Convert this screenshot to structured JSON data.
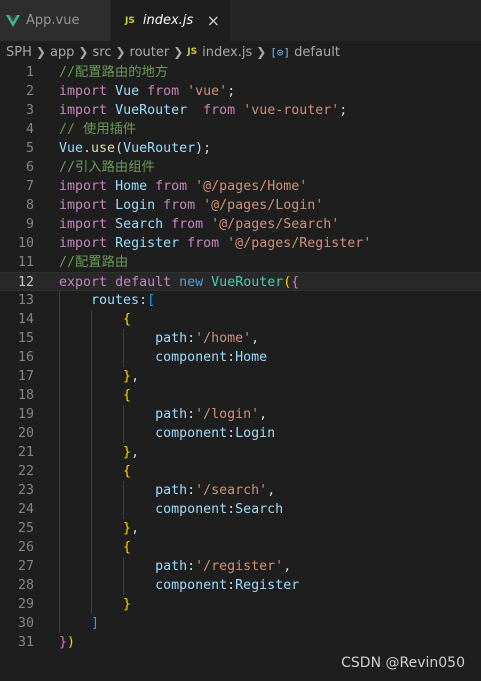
{
  "tabs": [
    {
      "label": "App.vue",
      "icon": "vue-icon",
      "active": false
    },
    {
      "label": "index.js",
      "icon": "js-icon",
      "active": true,
      "close": "×"
    }
  ],
  "breadcrumb": {
    "items": [
      "SPH",
      "app",
      "src",
      "router",
      "index.js",
      "default"
    ],
    "js_badge": "JS",
    "symbol_icon": "[⊙]"
  },
  "editor": {
    "current_line": 12,
    "lines": [
      [
        [
          "comment",
          "//配置路由的地方"
        ]
      ],
      [
        [
          "keyword",
          "import"
        ],
        [
          "plain",
          " "
        ],
        [
          "var",
          "Vue"
        ],
        [
          "plain",
          " "
        ],
        [
          "keyword",
          "from"
        ],
        [
          "plain",
          " "
        ],
        [
          "string",
          "'vue'"
        ],
        [
          "plain",
          ";"
        ]
      ],
      [
        [
          "keyword",
          "import"
        ],
        [
          "plain",
          " "
        ],
        [
          "var",
          "VueRouter"
        ],
        [
          "plain",
          "  "
        ],
        [
          "keyword",
          "from"
        ],
        [
          "plain",
          " "
        ],
        [
          "string",
          "'vue-router'"
        ],
        [
          "plain",
          ";"
        ]
      ],
      [
        [
          "comment",
          "// 使用插件"
        ]
      ],
      [
        [
          "var",
          "Vue"
        ],
        [
          "plain",
          "."
        ],
        [
          "fn",
          "use"
        ],
        [
          "plain",
          "("
        ],
        [
          "var",
          "VueRouter"
        ],
        [
          "plain",
          ");"
        ]
      ],
      [
        [
          "comment",
          "//引入路由组件"
        ]
      ],
      [
        [
          "keyword",
          "import"
        ],
        [
          "plain",
          " "
        ],
        [
          "var",
          "Home"
        ],
        [
          "plain",
          " "
        ],
        [
          "keyword",
          "from"
        ],
        [
          "plain",
          " "
        ],
        [
          "string",
          "'@/pages/Home'"
        ]
      ],
      [
        [
          "keyword",
          "import"
        ],
        [
          "plain",
          " "
        ],
        [
          "var",
          "Login"
        ],
        [
          "plain",
          " "
        ],
        [
          "keyword",
          "from"
        ],
        [
          "plain",
          " "
        ],
        [
          "string",
          "'@/pages/Login'"
        ]
      ],
      [
        [
          "keyword",
          "import"
        ],
        [
          "plain",
          " "
        ],
        [
          "var",
          "Search"
        ],
        [
          "plain",
          " "
        ],
        [
          "keyword",
          "from"
        ],
        [
          "plain",
          " "
        ],
        [
          "string",
          "'@/pages/Search'"
        ]
      ],
      [
        [
          "keyword",
          "import"
        ],
        [
          "plain",
          " "
        ],
        [
          "var",
          "Register"
        ],
        [
          "plain",
          " "
        ],
        [
          "keyword",
          "from"
        ],
        [
          "plain",
          " "
        ],
        [
          "string",
          "'@/pages/Register'"
        ]
      ],
      [
        [
          "comment",
          "//配置路由"
        ]
      ],
      [
        [
          "keyword",
          "export"
        ],
        [
          "plain",
          " "
        ],
        [
          "keyword",
          "default"
        ],
        [
          "plain",
          " "
        ],
        [
          "blue",
          "new"
        ],
        [
          "plain",
          " "
        ],
        [
          "class",
          "VueRouter"
        ],
        [
          "bracket1",
          "("
        ],
        [
          "bracket2",
          "{"
        ]
      ],
      [
        [
          "plain",
          "    "
        ],
        [
          "var",
          "routes"
        ],
        [
          "plain",
          ":"
        ],
        [
          "bracket3",
          "["
        ]
      ],
      [
        [
          "plain",
          "        "
        ],
        [
          "bracket1",
          "{"
        ]
      ],
      [
        [
          "plain",
          "            "
        ],
        [
          "var",
          "path"
        ],
        [
          "plain",
          ":"
        ],
        [
          "string",
          "'/home'"
        ],
        [
          "plain",
          ","
        ]
      ],
      [
        [
          "plain",
          "            "
        ],
        [
          "var",
          "component"
        ],
        [
          "plain",
          ":"
        ],
        [
          "var",
          "Home"
        ]
      ],
      [
        [
          "plain",
          "        "
        ],
        [
          "bracket1",
          "}"
        ],
        [
          "plain",
          ","
        ]
      ],
      [
        [
          "plain",
          "        "
        ],
        [
          "bracket1",
          "{"
        ]
      ],
      [
        [
          "plain",
          "            "
        ],
        [
          "var",
          "path"
        ],
        [
          "plain",
          ":"
        ],
        [
          "string",
          "'/login'"
        ],
        [
          "plain",
          ","
        ]
      ],
      [
        [
          "plain",
          "            "
        ],
        [
          "var",
          "component"
        ],
        [
          "plain",
          ":"
        ],
        [
          "var",
          "Login"
        ]
      ],
      [
        [
          "plain",
          "        "
        ],
        [
          "bracket1",
          "}"
        ],
        [
          "plain",
          ","
        ]
      ],
      [
        [
          "plain",
          "        "
        ],
        [
          "bracket1",
          "{"
        ]
      ],
      [
        [
          "plain",
          "            "
        ],
        [
          "var",
          "path"
        ],
        [
          "plain",
          ":"
        ],
        [
          "string",
          "'/search'"
        ],
        [
          "plain",
          ","
        ]
      ],
      [
        [
          "plain",
          "            "
        ],
        [
          "var",
          "component"
        ],
        [
          "plain",
          ":"
        ],
        [
          "var",
          "Search"
        ]
      ],
      [
        [
          "plain",
          "        "
        ],
        [
          "bracket1",
          "}"
        ],
        [
          "plain",
          ","
        ]
      ],
      [
        [
          "plain",
          "        "
        ],
        [
          "bracket1",
          "{"
        ]
      ],
      [
        [
          "plain",
          "            "
        ],
        [
          "var",
          "path"
        ],
        [
          "plain",
          ":"
        ],
        [
          "string",
          "'/register'"
        ],
        [
          "plain",
          ","
        ]
      ],
      [
        [
          "plain",
          "            "
        ],
        [
          "var",
          "component"
        ],
        [
          "plain",
          ":"
        ],
        [
          "var",
          "Register"
        ]
      ],
      [
        [
          "plain",
          "        "
        ],
        [
          "bracket1",
          "}"
        ]
      ],
      [
        [
          "plain",
          "    "
        ],
        [
          "bracket3",
          "]"
        ]
      ],
      [
        [
          "bracket2",
          "}"
        ],
        [
          "bracket1",
          ")"
        ]
      ]
    ]
  },
  "watermark": "CSDN @Revin050",
  "colors": {
    "background": "#1e1e1e",
    "comment": "#6a9955",
    "keyword": "#c586c0",
    "string": "#ce9178",
    "variable": "#9cdcfe"
  }
}
